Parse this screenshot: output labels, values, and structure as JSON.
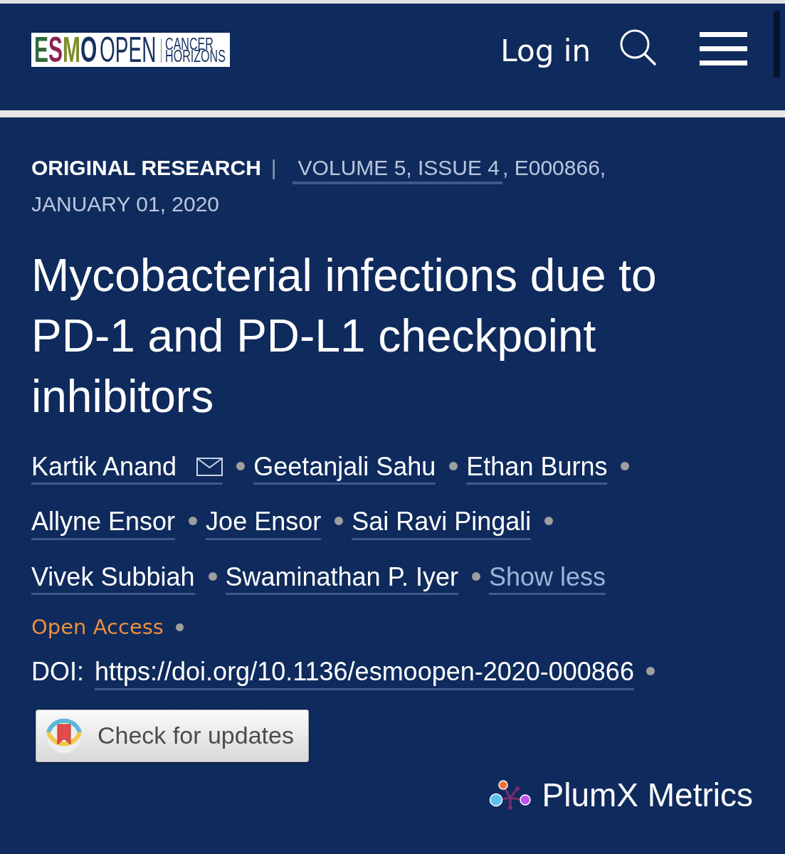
{
  "header": {
    "logo": {
      "mark": "ESMO",
      "name": "OPEN",
      "tagline": [
        "CANCER",
        "HORIZONS"
      ]
    },
    "login": "Log in"
  },
  "article": {
    "type": "ORIGINAL RESEARCH",
    "separator": "|",
    "issue_link": "VOLUME 5, ISSUE 4",
    "citation": ", E000866,",
    "date": "JANUARY 01, 2020",
    "title": "Mycobacterial infections due to PD-1 and PD-L1 checkpoint inhibitors",
    "authors": [
      {
        "name": "Kartik Anand",
        "email": true
      },
      {
        "name": "Geetanjali Sahu",
        "email": false
      },
      {
        "name": "Ethan Burns",
        "email": false
      },
      {
        "name": "Allyne Ensor",
        "email": false
      },
      {
        "name": "Joe Ensor",
        "email": false
      },
      {
        "name": "Sai Ravi Pingali",
        "email": false
      },
      {
        "name": "Vivek Subbiah",
        "email": false
      },
      {
        "name": "Swaminathan P. Iyer",
        "email": false
      }
    ],
    "author_toggle": "Show less",
    "access": "Open Access",
    "doi_label": "DOI:",
    "doi": "https://doi.org/10.1136/esmoopen-2020-000866",
    "update_button": "Check for updates",
    "metrics": "PlumX Metrics"
  }
}
